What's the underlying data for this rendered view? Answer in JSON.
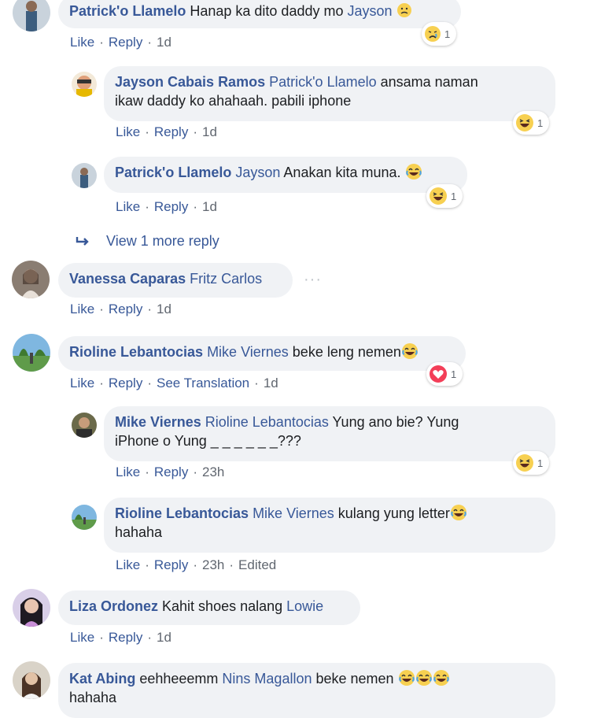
{
  "actions": {
    "like": "Like",
    "reply": "Reply",
    "see_translation": "See Translation",
    "edited": "Edited"
  },
  "colors": {
    "link": "#385898",
    "bubble": "#f0f2f5",
    "meta": "#616770"
  },
  "comments": [
    {
      "author": "Patrick'o Llamelo",
      "mention": "Jayson",
      "pre": "Hanap ka dito daddy mo ",
      "post": "",
      "emoji": "sad-face-icon",
      "time": "1d",
      "reaction": {
        "type": "sad",
        "count": "1"
      }
    },
    {
      "author": "Jayson Cabais Ramos",
      "mention": "Patrick'o Llamelo",
      "text_line1": "ansama naman",
      "text_line2": "ikaw daddy ko ahahaah. pabili iphone",
      "time": "1d",
      "reaction": {
        "type": "haha",
        "count": "1"
      }
    },
    {
      "author": "Patrick'o Llamelo",
      "mention": "Jayson",
      "text": "Anakan kita muna.",
      "emoji": "laughing-face-icon",
      "time": "1d",
      "reaction": {
        "type": "haha",
        "count": "1"
      }
    },
    {
      "view_more": "View 1 more reply"
    },
    {
      "author": "Vanessa Caparas",
      "mention": "Fritz Carlos",
      "time": "1d",
      "more": "···"
    },
    {
      "author": "Rioline Lebantocias",
      "mention": "Mike Viernes",
      "text": "beke leng nemen",
      "emoji": "laughing-face-icon",
      "time": "1d",
      "reaction": {
        "type": "love",
        "count": "1"
      }
    },
    {
      "author": "Mike Viernes",
      "mention": "Rioline Lebantocias",
      "text_line1": "Yung ano bie? Yung",
      "text_line2": "iPhone o Yung _ _ _ _ _ _???",
      "time": "23h",
      "reaction": {
        "type": "haha",
        "count": "1"
      }
    },
    {
      "author": "Rioline Lebantocias",
      "mention": "Mike Viernes",
      "text_line1": "kulang yung letter",
      "text_line2": "hahaha",
      "emoji": "laughing-face-icon",
      "time": "23h"
    },
    {
      "author": "Liza Ordonez",
      "text": "Kahit shoes nalang ",
      "mention": "Lowie",
      "time": "1d"
    },
    {
      "author": "Kat Abing",
      "text": "eehheeemm ",
      "mention": "Nins Magallon",
      "text_after": "beke nemen",
      "text_line2": "hahaha",
      "emoji": "laughing-face-icon"
    }
  ]
}
